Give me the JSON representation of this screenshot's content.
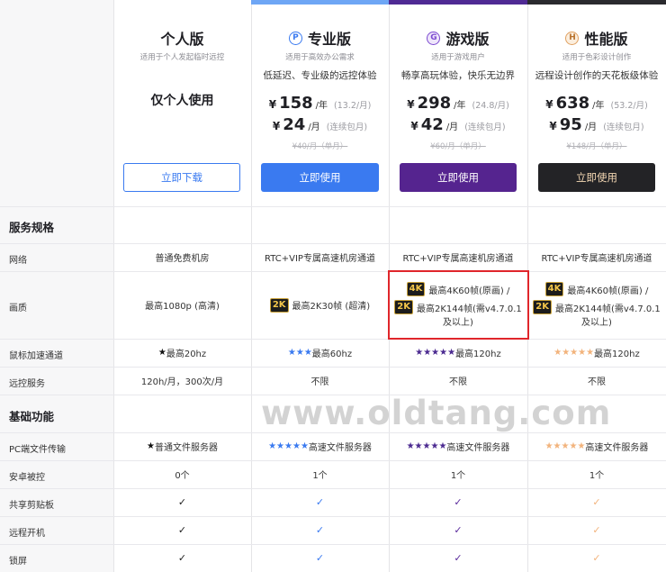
{
  "colors": {
    "pro_accent": "#3a7af0",
    "game_accent": "#5a2a9c",
    "perf_accent": "#232326",
    "perf_star": "#f2b37c",
    "highlight": "#e0262b"
  },
  "plans": [
    {
      "title": "个人版",
      "subtitle": "适用于个人发起临时远控",
      "big_text": "仅个人使用",
      "button": "立即下载"
    },
    {
      "title": "专业版",
      "badge": "P",
      "subtitle": "适用于高效办公需求",
      "desc": "低延迟、专业级的远控体验",
      "price_year": "158",
      "year_unit": "/年",
      "year_note": "(13.2/月)",
      "price_month": "24",
      "month_unit": "/月",
      "month_note": "(连续包月)",
      "strike": "¥40/月（单月）",
      "button": "立即使用"
    },
    {
      "title": "游戏版",
      "badge": "G",
      "subtitle": "适用于游戏用户",
      "desc": "畅享高玩体验，快乐无边界",
      "price_year": "298",
      "year_unit": "/年",
      "year_note": "(24.8/月)",
      "price_month": "42",
      "month_unit": "/月",
      "month_note": "(连续包月)",
      "strike": "¥60/月（单月）",
      "button": "立即使用"
    },
    {
      "title": "性能版",
      "badge": "H",
      "subtitle": "适用于色彩设计创作",
      "desc": "远程设计创作的天花板级体验",
      "price_year": "638",
      "year_unit": "/年",
      "year_note": "(53.2/月)",
      "price_month": "95",
      "month_unit": "/月",
      "month_note": "(连续包月)",
      "strike": "¥148/月（单月）",
      "button": "立即使用"
    }
  ],
  "currency": "¥",
  "sections": {
    "spec": "服务规格",
    "basic": "基础功能"
  },
  "rows": {
    "network": {
      "label": "网络",
      "values": [
        "普通免费机房",
        "RTC+VIP专属高速机房通道",
        "RTC+VIP专属高速机房通道",
        "RTC+VIP专属高速机房通道"
      ]
    },
    "quality": {
      "label": "画质",
      "personal": "最高1080p (高清)",
      "pro_badge": "2K",
      "pro_text": "最高2K30帧 (超清)",
      "game_badge1": "4K",
      "game_line1": "最高4K60帧(原画) /",
      "game_badge2": "2K",
      "game_line2": "最高2K144帧(需v4.7.0.1",
      "game_line3": "及以上)",
      "perf_badge1": "4K",
      "perf_line1": "最高4K60帧(原画) /",
      "perf_badge2": "2K",
      "perf_line2": "最高2K144帧(需v4.7.0.1",
      "perf_line3": "及以上)"
    },
    "mouse": {
      "label": "鼠标加速通道",
      "values": [
        "最高20hz",
        "最高60hz",
        "最高120hz",
        "最高120hz"
      ],
      "stars": [
        1,
        3,
        5,
        5
      ]
    },
    "remote": {
      "label": "远控服务",
      "values": [
        "120h/月，300次/月",
        "不限",
        "不限",
        "不限"
      ]
    },
    "pc_transfer": {
      "label": "PC端文件传输",
      "values": [
        "普通文件服务器",
        "高速文件服务器",
        "高速文件服务器",
        "高速文件服务器"
      ],
      "stars": [
        1,
        5,
        5,
        5
      ]
    },
    "android": {
      "label": "安卓被控",
      "values": [
        "0个",
        "1个",
        "1个",
        "1个"
      ]
    },
    "clipboard": {
      "label": "共享剪贴板",
      "check": "✓"
    },
    "power_on": {
      "label": "远程开机",
      "check": "✓"
    },
    "lock": {
      "label": "锁屏",
      "check": "✓"
    }
  },
  "watermark": "www.oldtang.com"
}
